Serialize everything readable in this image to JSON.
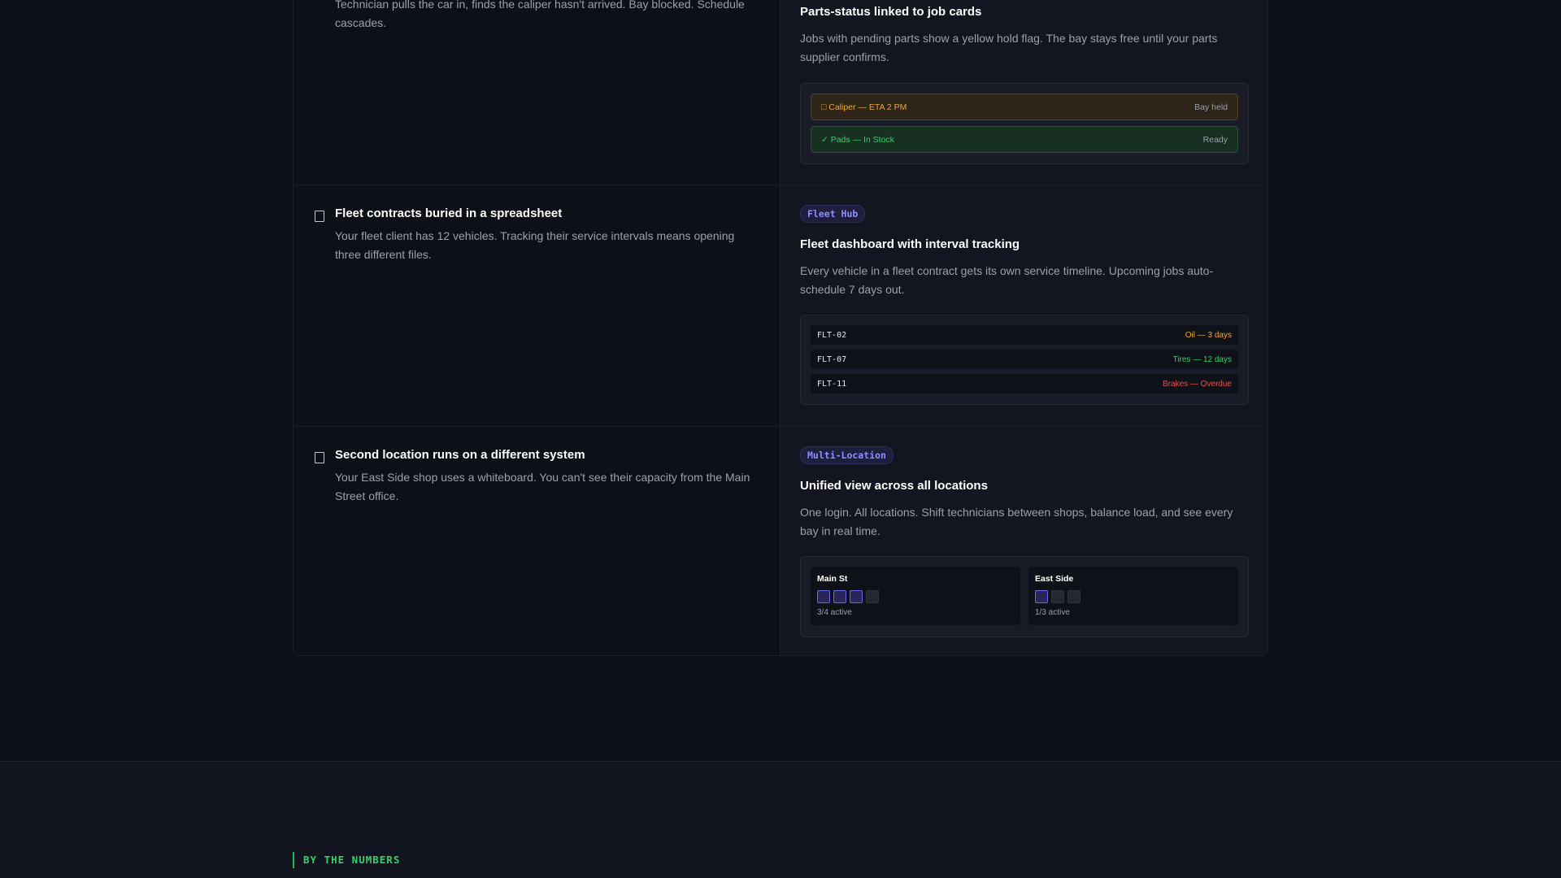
{
  "rows": [
    {
      "pain": {
        "desc": "Technician pulls the car in, finds the caliper hasn't arrived. Bay blocked. Schedule cascades."
      },
      "solution": {
        "title": "Parts-status linked to job cards",
        "desc": "Jobs with pending parts show a yellow hold flag. The bay stays free until your parts supplier confirms.",
        "parts": [
          {
            "label": "□ Caliper — ETA 2 PM",
            "status": "Bay held",
            "state": "hold"
          },
          {
            "label": "✓ Pads — In Stock",
            "status": "Ready",
            "state": "ready"
          }
        ]
      }
    },
    {
      "pain": {
        "title": "Fleet contracts buried in a spreadsheet",
        "desc": "Your fleet client has 12 vehicles. Tracking their service intervals means opening three different files."
      },
      "solution": {
        "badge": "Fleet Hub",
        "title": "Fleet dashboard with interval tracking",
        "desc": "Every vehicle in a fleet contract gets its own service timeline. Upcoming jobs auto-schedule 7 days out.",
        "fleet": [
          {
            "id": "FLT-02",
            "status": "Oil — 3 days",
            "color": "#f0a53b"
          },
          {
            "id": "FLT-07",
            "status": "Tires — 12 days",
            "color": "#34d06a"
          },
          {
            "id": "FLT-11",
            "status": "Brakes — Overdue",
            "color": "#f04d4d"
          }
        ]
      }
    },
    {
      "pain": {
        "title": "Second location runs on a different system",
        "desc": "Your East Side shop uses a whiteboard. You can't see their capacity from the Main Street office."
      },
      "solution": {
        "badge": "Multi-Location",
        "title": "Unified view across all locations",
        "desc": "One login. All locations. Shift technicians between shops, balance load, and see every bay in real time.",
        "locations": [
          {
            "name": "Main St",
            "active": 3,
            "total": 4,
            "caption": "3/4 active"
          },
          {
            "name": "East Side",
            "active": 1,
            "total": 3,
            "caption": "1/3 active"
          }
        ]
      }
    }
  ],
  "section": {
    "eyebrow": "BY THE NUMBERS"
  },
  "colors": {
    "accent": "#6d68e8",
    "warning": "#f0a53b",
    "success": "#34d06a",
    "danger": "#f04d4d"
  }
}
